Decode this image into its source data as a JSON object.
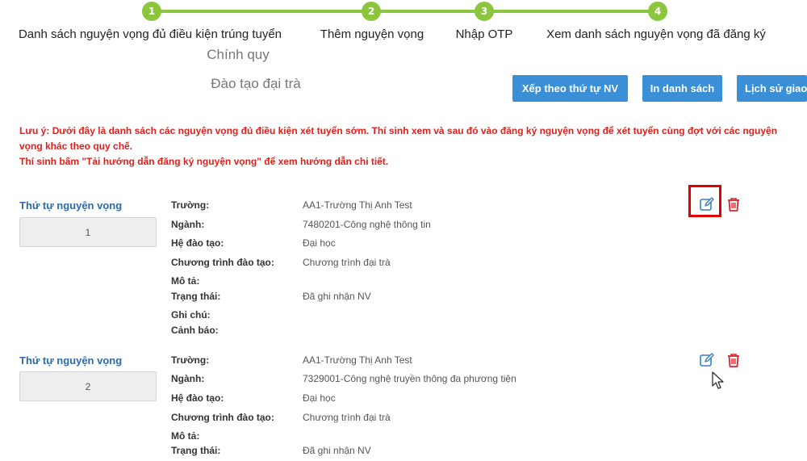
{
  "steps": [
    {
      "number": "1",
      "label": "Danh sách nguyện vọng đủ điều kiện trúng tuyển"
    },
    {
      "number": "2",
      "label": "Thêm nguyện vọng"
    },
    {
      "number": "3",
      "label": "Nhập OTP"
    },
    {
      "number": "4",
      "label": "Xem danh sách nguyện vọng đã đăng ký"
    }
  ],
  "headings": {
    "program": "Chính quy",
    "training": "Đào tạo đại trà"
  },
  "toolbar": {
    "sort_label": "Xếp theo thứ tự NV",
    "print_label": "In danh sách",
    "history_label": "Lịch sử giao"
  },
  "notice": {
    "line1": "Lưu ý: Dưới đây là danh sách các nguyện vọng đủ điều kiện xét tuyển sớm. Thí sinh xem và sau đó vào đăng ký nguyện vọng để xét tuyển cùng đợt với các nguyện vọng khác theo quy chế.",
    "line2": "Thí sinh bấm \"Tải hướng dẫn đăng ký nguyện vọng\" để xem hướng dẫn chi tiết."
  },
  "labels": {
    "order_title": "Thứ tự nguyện vọng",
    "school": "Trường:",
    "major": "Ngành:",
    "system": "Hệ đào tạo:",
    "program": "Chương trình đào tạo:",
    "description": "Mô tả:",
    "status": "Trạng thái:",
    "note": "Ghi chú:",
    "warning": "Cảnh báo:"
  },
  "wishes": [
    {
      "order": "1",
      "school": "AA1-Trường Thị Anh Test",
      "major": "7480201-Công nghệ thông tin",
      "system": "Đại học",
      "program": "Chương trình đại trà",
      "description": "",
      "status": "Đã ghi nhận NV",
      "note": "",
      "warning": ""
    },
    {
      "order": "2",
      "school": "AA1-Trường Thị Anh Test",
      "major": "7329001-Công nghệ truyền thông đa phương tiện",
      "system": "Đại học",
      "program": "Chương trình đại trà",
      "description": "",
      "status": "Đã ghi nhận NV"
    }
  ],
  "icons": {
    "edit": "edit-icon",
    "delete": "trash-icon",
    "cursor": "mouse-pointer-icon"
  },
  "colors": {
    "step_green": "#8cc63f",
    "button_blue": "#3a8fd6",
    "notice_red": "#e0201b",
    "title_blue": "#2f6aa8",
    "delete_red": "#d9232d",
    "highlight_red": "#e00000"
  }
}
